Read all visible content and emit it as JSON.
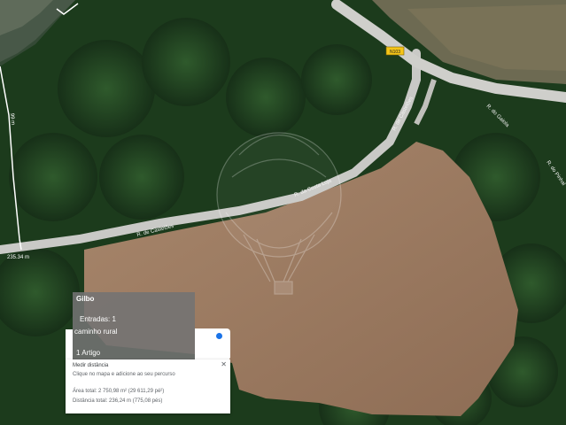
{
  "map": {
    "type": "satellite-view",
    "colors": {
      "field": "#9d7b62",
      "forest": "#1c3b1c",
      "road": "#c9c9c6",
      "boundary": "#ffffff"
    },
    "road_labels": [
      "R. da Costa Loja",
      "R. de Castelões",
      "R. de Castelões",
      "R. do Gaiola",
      "R. do Pinhal"
    ],
    "route_shield": "N103",
    "boundary_labels": [
      "99 m",
      "235.34 m"
    ],
    "watermark_icon": "hot-air-balloon-icon"
  },
  "info_panel": {
    "title": "Gilbo",
    "entries_label": "Entradas: 1",
    "road_type": "caminho rural",
    "category": "1 Artigo"
  },
  "measure_panel": {
    "title": "Medir distância",
    "hint": "Clique no mapa e adicione ao seu percurso",
    "area": "Área total: 2 750,98 m² (29 611,29 pé²)",
    "distance": "Distância total: 236,24 m (775,08 pés)",
    "close_icon": "close-icon"
  }
}
